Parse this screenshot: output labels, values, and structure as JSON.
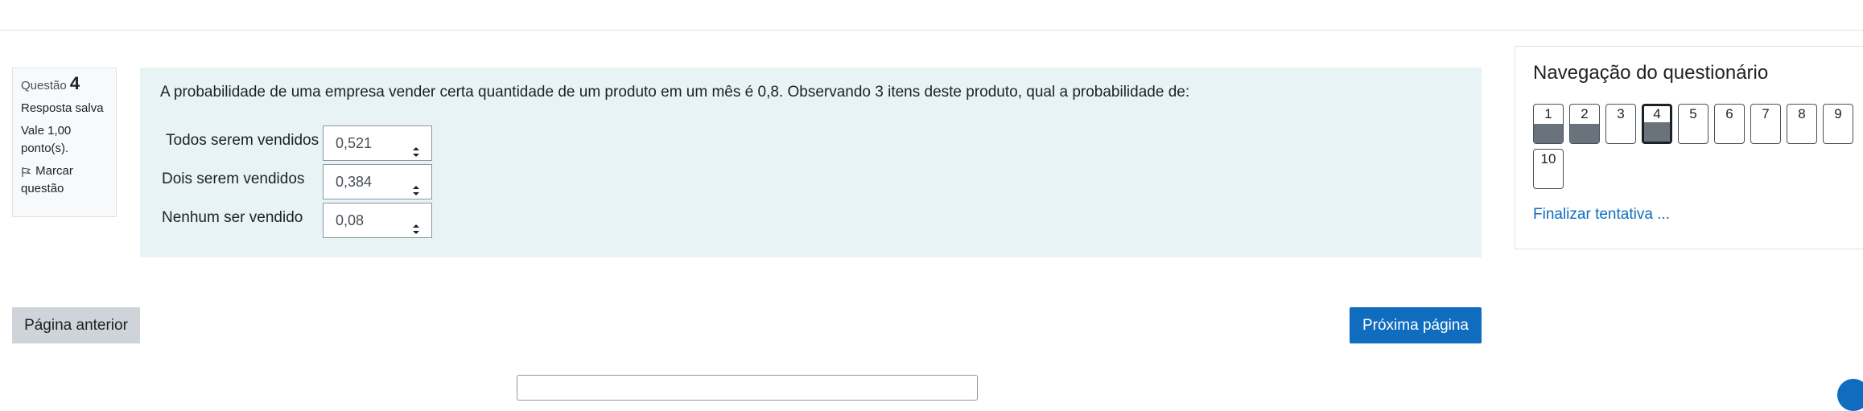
{
  "question_info": {
    "label": "Questão",
    "number": "4",
    "status": "Resposta salva",
    "points": "Vale 1,00 ponto(s).",
    "flag_label": "Marcar questão"
  },
  "question": {
    "text": "A probabilidade de uma empresa vender certa quantidade de um produto em um mês é 0,8. Observando 3 itens deste produto, qual a probabilidade de:",
    "rows": [
      {
        "label": "Todos serem vendidos",
        "value": "0,521"
      },
      {
        "label": "Dois serem vendidos",
        "value": "0,384"
      },
      {
        "label": "Nenhum ser vendido",
        "value": "0,08"
      }
    ]
  },
  "navigation": {
    "title": "Navegação do questionário",
    "questions": [
      {
        "label": "1",
        "state": "answered"
      },
      {
        "label": "2",
        "state": "answered"
      },
      {
        "label": "3",
        "state": "unanswered"
      },
      {
        "label": "4",
        "state": "current-answered"
      },
      {
        "label": "5",
        "state": "unanswered"
      },
      {
        "label": "6",
        "state": "unanswered"
      },
      {
        "label": "7",
        "state": "unanswered"
      },
      {
        "label": "8",
        "state": "unanswered"
      },
      {
        "label": "9",
        "state": "unanswered"
      },
      {
        "label": "10",
        "state": "unanswered"
      }
    ],
    "finish_link": "Finalizar tentativa ..."
  },
  "buttons": {
    "previous": "Página anterior",
    "next": "Próxima página"
  },
  "colors": {
    "accent": "#0f6cbf",
    "question_bg": "#e7f3f5",
    "answered_fill": "#6a737b"
  }
}
